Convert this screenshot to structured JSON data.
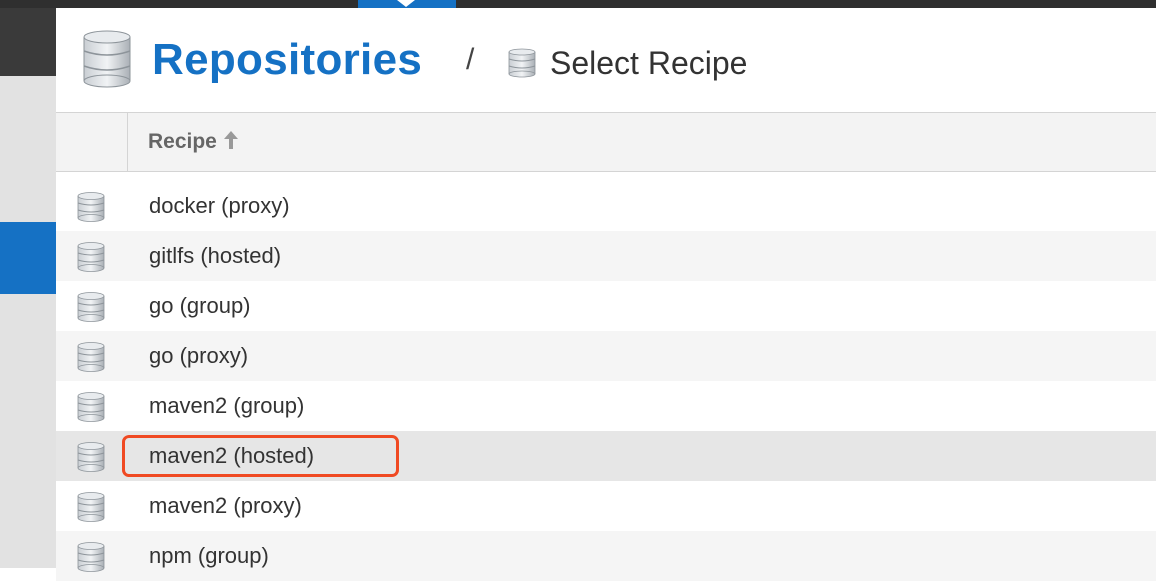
{
  "breadcrumb": {
    "title": "Repositories",
    "separator": "/",
    "subtitle": "Select Recipe",
    "title_icon": "database-icon",
    "subtitle_icon": "database-icon"
  },
  "table": {
    "header": {
      "column": "Recipe",
      "sort_icon": "arrow-up-icon",
      "sort_direction": "ascending"
    },
    "rows": [
      {
        "label": "docker (proxy)",
        "icon": "database-icon"
      },
      {
        "label": "gitlfs (hosted)",
        "icon": "database-icon"
      },
      {
        "label": "go (group)",
        "icon": "database-icon"
      },
      {
        "label": "go (proxy)",
        "icon": "database-icon"
      },
      {
        "label": "maven2 (group)",
        "icon": "database-icon"
      },
      {
        "label": "maven2 (hosted)",
        "icon": "database-icon",
        "highlighted": true
      },
      {
        "label": "maven2 (proxy)",
        "icon": "database-icon"
      },
      {
        "label": "npm (group)",
        "icon": "database-icon"
      }
    ]
  },
  "colors": {
    "accent": "#1571c4",
    "highlight": "#f04a23"
  }
}
